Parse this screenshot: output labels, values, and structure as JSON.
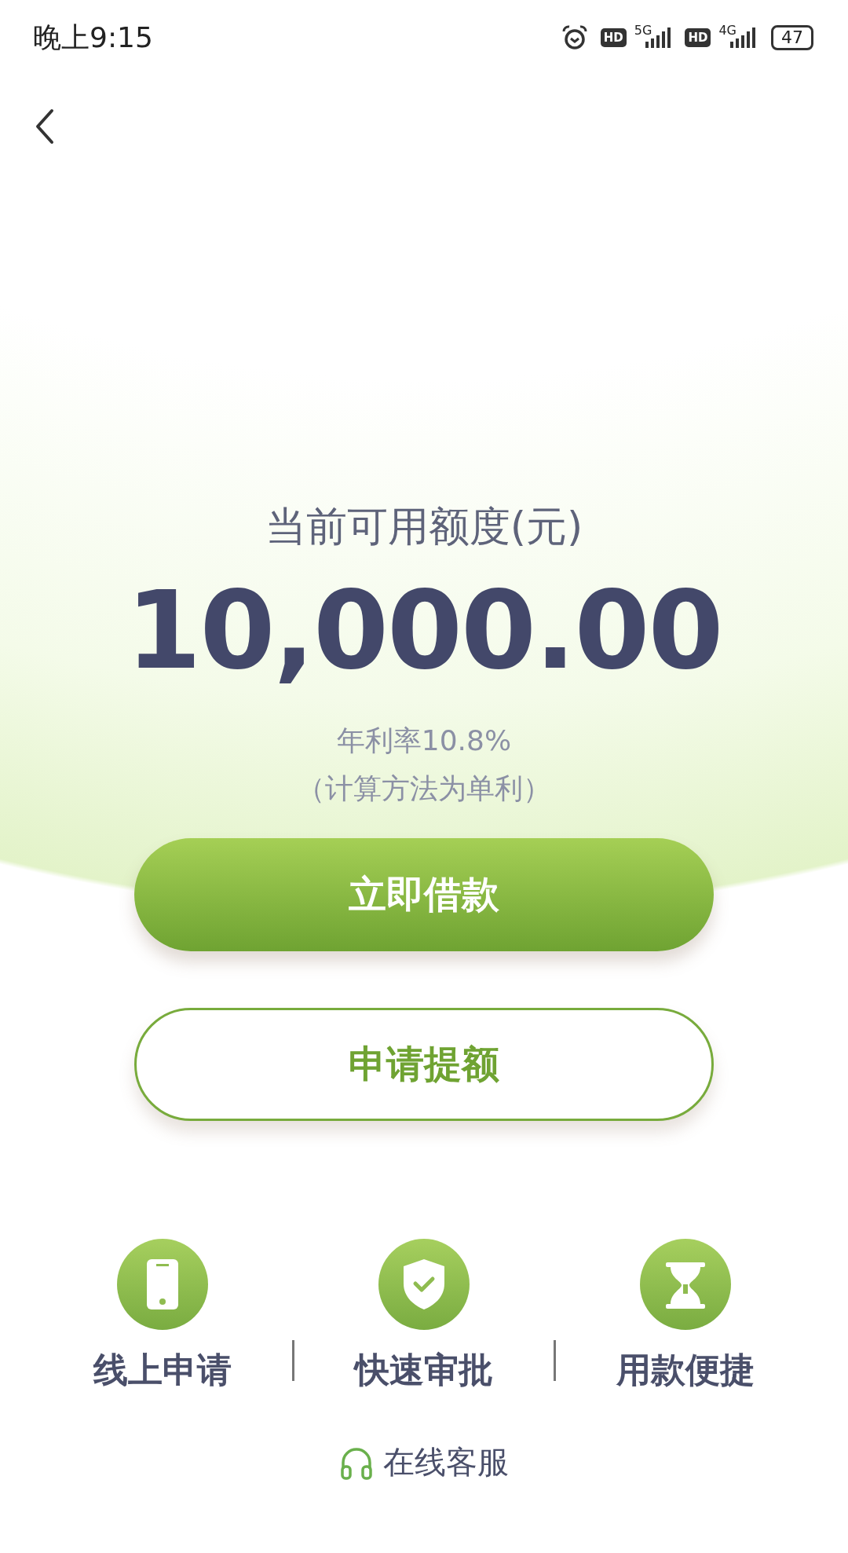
{
  "status_bar": {
    "time": "晚上9:15",
    "networks": [
      {
        "badge": "HD",
        "label": "5G"
      },
      {
        "badge": "HD",
        "label": "4G"
      }
    ],
    "battery": "47"
  },
  "credit": {
    "label": "当前可用额度(元)",
    "amount": "10,000.00",
    "rate": "年利率10.8%",
    "note": "（计算方法为单利）"
  },
  "buttons": [
    {
      "label": "立即借款",
      "kind": "primary"
    },
    {
      "label": "申请提额",
      "kind": "outline"
    }
  ],
  "features": [
    {
      "label": "线上申请"
    },
    {
      "label": "快速审批"
    },
    {
      "label": "用款便捷"
    }
  ],
  "support": {
    "label": "在线客服"
  }
}
